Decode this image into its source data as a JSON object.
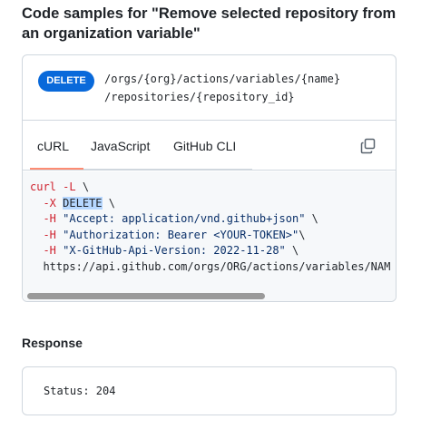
{
  "heading": "Code samples for \"Remove selected repository from an organization variable\"",
  "endpoint": {
    "method": "DELETE",
    "path_line1": "/orgs/{org}/actions/variables/{name}",
    "path_line2": "/repositories/{repository_id}"
  },
  "tabs": [
    {
      "label": "cURL",
      "active": true
    },
    {
      "label": "JavaScript",
      "active": false
    },
    {
      "label": "GitHub CLI",
      "active": false
    }
  ],
  "copy_icon": "copy-icon",
  "code": {
    "cmd": "curl",
    "flag_L": "-L",
    "flag_X": "-X",
    "method": "DELETE",
    "h1_flag": "-H",
    "h1_value": "\"Accept: application/vnd.github+json\"",
    "h2_flag": "-H",
    "h2_value": "\"Authorization: Bearer <YOUR-TOKEN>\"",
    "h3_flag": "-H",
    "h3_value": "\"X-GitHub-Api-Version: 2022-11-28\"",
    "url": "https://api.github.com/orgs/ORG/actions/variables/NAM"
  },
  "response": {
    "label": "Response",
    "status": "Status: 204"
  },
  "colors": {
    "badge": "#0969da",
    "tab_active": "#fd8c73",
    "keyword": "#cf222e",
    "string": "#0a3069",
    "selection": "#b6d7ff"
  }
}
